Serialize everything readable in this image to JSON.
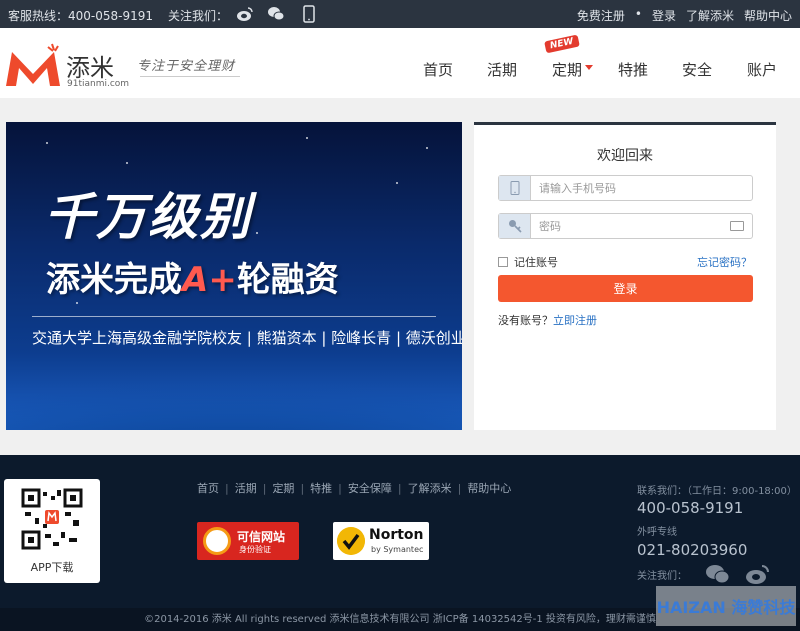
{
  "topbar": {
    "hotline": "客服热线：400-058-9191",
    "follow_label": "关注我们：",
    "icons": [
      "weibo-icon",
      "wechat-icon",
      "mobile-icon"
    ],
    "register": "免费注册",
    "separator": "•",
    "login": "登录",
    "about": "了解添米",
    "help": "帮助中心"
  },
  "header": {
    "logo_name": "添米",
    "logo_domain": "91tianmi.com",
    "slogan": "专注于安全理财",
    "nav": [
      "首页",
      "活期",
      "定期",
      "特推",
      "安全",
      "账户"
    ],
    "new_badge": "NEW"
  },
  "banner": {
    "line1": "千万级别",
    "line2_pre": "添米完成",
    "line2_hl": "A+",
    "line2_post": "轮融资",
    "line3": "交通大学上海高级金融学院校友 | 熊猫资本 | 险峰长青 | 德沃创业"
  },
  "login": {
    "title": "欢迎回来",
    "phone_placeholder": "请输入手机号码",
    "password_placeholder": "密码",
    "remember": "记住账号",
    "forgot": "忘记密码？",
    "submit": "登录",
    "no_account": "没有账号？",
    "register": "立即注册"
  },
  "footer": {
    "qr_label": "APP下载",
    "links": [
      "首页",
      "活期",
      "定期",
      "特推",
      "安全保障",
      "了解添米",
      "帮助中心"
    ],
    "badge_trusted_title": "可信网站",
    "badge_trusted_sub": "身份验证",
    "badge_norton_title": "Norton",
    "badge_norton_sub": "by Symantec",
    "contact_label": "联系我们：（工作日：9:00-18:00）",
    "contact_phone": "400-058-9191",
    "outbound_label": "外呼专线",
    "outbound_phone": "021-80203960",
    "follow_label": "关注我们："
  },
  "copyright": "©2014-2016 添米 All rights reserved 添米信息技术有限公司 浙ICP备 14032542号-1   投资有风险，理财需谨慎",
  "watermark": "HAIZAN 海赞科技",
  "colors": {
    "topbar": "#2b3440",
    "accent": "#f4572f",
    "link": "#2a72c4",
    "footer": "#0c1a2c"
  }
}
